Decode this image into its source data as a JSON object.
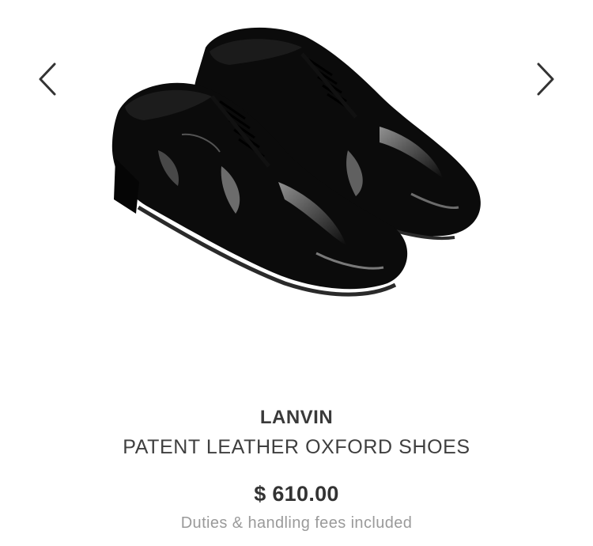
{
  "gallery": {
    "prev_icon": "chevron-left-icon",
    "next_icon": "chevron-right-icon",
    "image_alt": "Black patent leather oxford shoes"
  },
  "product": {
    "brand": "LANVIN",
    "name": "PATENT LEATHER OXFORD SHOES",
    "price": "$ 610.00",
    "fees_note": "Duties & handling fees included"
  },
  "colors": {
    "brand_text": "#3a3a3a",
    "muted_text": "#9a9a9a",
    "shoe": "#0b0b0b",
    "arrow": "#333333"
  }
}
